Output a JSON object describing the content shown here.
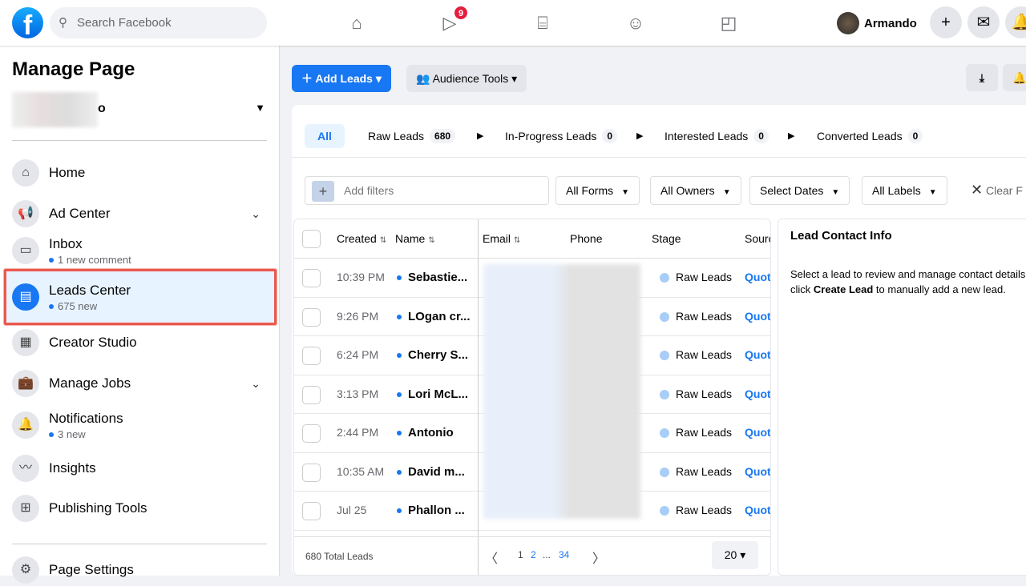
{
  "header": {
    "search_placeholder": "Search Facebook",
    "watch_badge": "9",
    "user_name": "Armando"
  },
  "sidebar": {
    "title": "Manage Page",
    "page_name_suffix": "o",
    "items": [
      {
        "label": "Home"
      },
      {
        "label": "Ad Center"
      },
      {
        "label": "Inbox",
        "sub": "1 new comment"
      },
      {
        "label": "Leads Center",
        "sub": "675 new"
      },
      {
        "label": "Creator Studio"
      },
      {
        "label": "Manage Jobs"
      },
      {
        "label": "Notifications",
        "sub": "3 new"
      },
      {
        "label": "Insights"
      },
      {
        "label": "Publishing Tools"
      },
      {
        "label": "Page Settings"
      }
    ]
  },
  "toolbar": {
    "add_leads": "Add Leads",
    "audience_tools": "Audience Tools"
  },
  "stages": {
    "all": "All",
    "raw": "Raw Leads",
    "raw_count": "680",
    "progress": "In-Progress Leads",
    "progress_count": "0",
    "interested": "Interested Leads",
    "interested_count": "0",
    "converted": "Converted Leads",
    "converted_count": "0"
  },
  "filters": {
    "add_placeholder": "Add filters",
    "forms": "All Forms",
    "owners": "All Owners",
    "dates": "Select Dates",
    "labels": "All Labels",
    "clear": "Clear F"
  },
  "table": {
    "headers": {
      "created": "Created",
      "name": "Name",
      "email": "Email",
      "phone": "Phone",
      "stage": "Stage",
      "source": "Sourc"
    },
    "rows": [
      {
        "created": "10:39 PM",
        "name": "Sebastie...",
        "stage": "Raw Leads",
        "source": "Quote"
      },
      {
        "created": "9:26 PM",
        "name": "LOgan cr...",
        "stage": "Raw Leads",
        "source": "Quote"
      },
      {
        "created": "6:24 PM",
        "name": "Cherry S...",
        "stage": "Raw Leads",
        "source": "Quote"
      },
      {
        "created": "3:13 PM",
        "name": "Lori McL...",
        "stage": "Raw Leads",
        "source": "Quote"
      },
      {
        "created": "2:44 PM",
        "name": "Antonio",
        "stage": "Raw Leads",
        "source": "Quote"
      },
      {
        "created": "10:35 AM",
        "name": "David m...",
        "stage": "Raw Leads",
        "source": "Quote"
      },
      {
        "created": "Jul 25",
        "name": "Phallon ...",
        "stage": "Raw Leads",
        "source": "Quote"
      }
    ]
  },
  "footer": {
    "total": "680 Total Leads",
    "page1": "1",
    "page2": "2",
    "ellipsis": "...",
    "last": "34",
    "per_page": "20"
  },
  "info": {
    "title": "Lead Contact Info",
    "text1": "Select a lead to review and manage contact details, or",
    "text2": "click ",
    "bold": "Create Lead",
    "text3": " to manually add a new lead."
  }
}
